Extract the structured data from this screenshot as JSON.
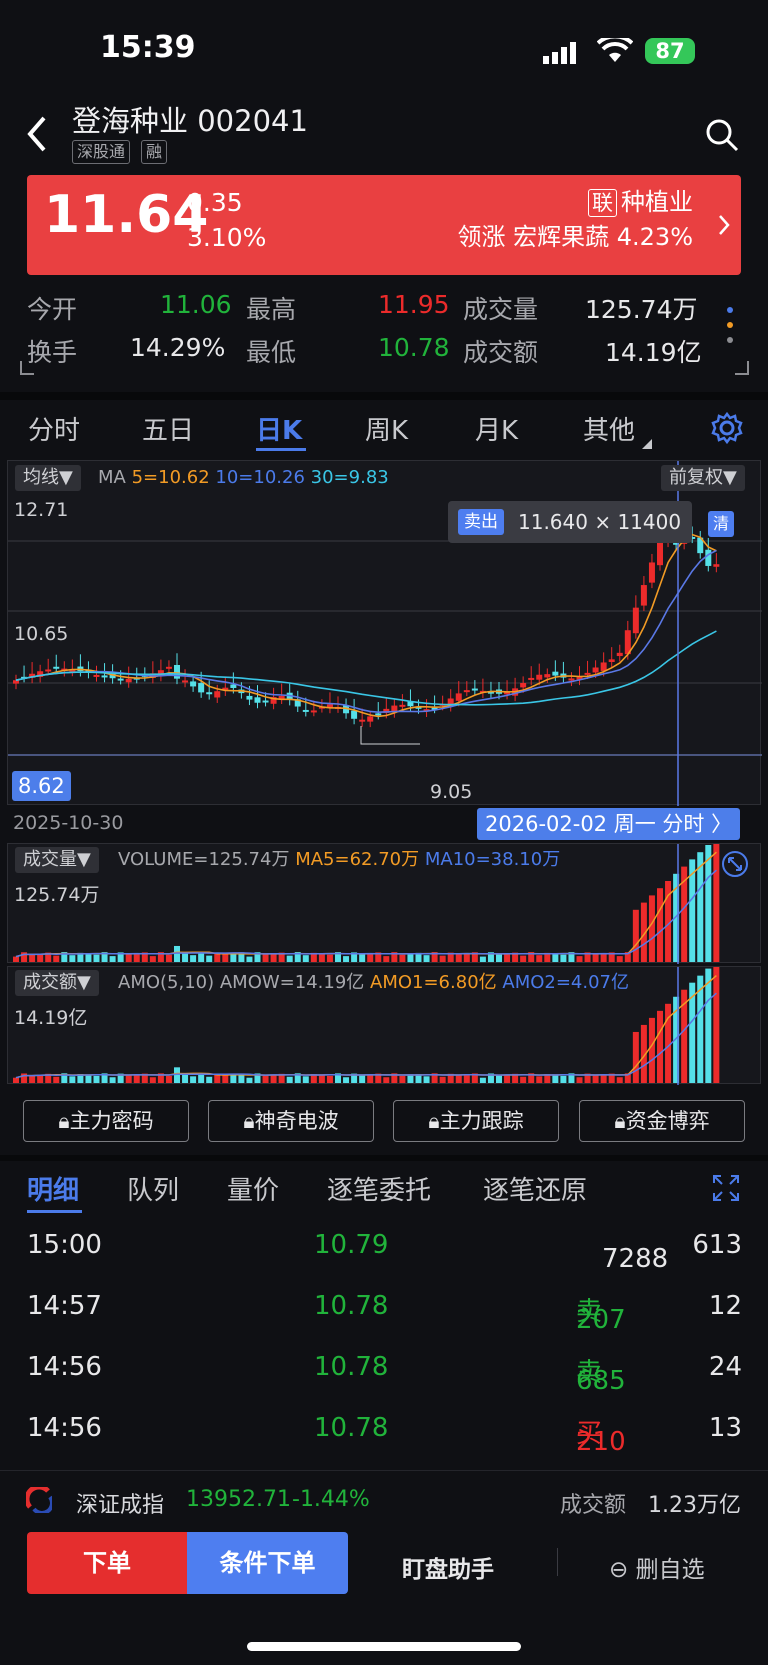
{
  "status": {
    "time": "15:39",
    "battery": "87"
  },
  "header": {
    "title": "登海种业 002041",
    "tags": [
      "深股通",
      "融"
    ]
  },
  "banner": {
    "price": "11.64",
    "change": "0.35",
    "change_pct": "3.10%",
    "sector_badge": "联",
    "sector": "种植业",
    "leader": "领涨 宏辉果蔬 4.23%",
    "color": "#e94041"
  },
  "stats": {
    "open_label": "今开",
    "open": "11.06",
    "high_label": "最高",
    "high": "11.95",
    "volume_label": "成交量",
    "volume": "125.74万",
    "turnover_label": "换手",
    "turnover": "14.29%",
    "low_label": "最低",
    "low": "10.78",
    "amount_label": "成交额",
    "amount": "14.19亿"
  },
  "ktabs": [
    "分时",
    "五日",
    "日K",
    "周K",
    "月K",
    "其他"
  ],
  "main_chart": {
    "ma_chip": "均线▼",
    "ma_label": "MA",
    "ma5": "5=10.62",
    "ma10": "10=10.26",
    "ma30": "30=9.83",
    "adjust_chip": "前复权▼",
    "y_top": "12.71",
    "y_mid": "10.65",
    "y_bottom": "8.62",
    "low_marker": "9.05",
    "tooltip_badge": "卖出",
    "tooltip_text": "11.640 × 11400",
    "clear_badge": "清",
    "date_left": "2025-10-30",
    "date_right": "2026-02-02 周一 分时 〉"
  },
  "vol_chart": {
    "chip": "成交量▼",
    "legend_main": "VOLUME=125.74万",
    "ma5": "MA5=62.70万",
    "ma10": "MA10=38.10万",
    "y_top": "125.74万"
  },
  "amo_chart": {
    "chip": "成交额▼",
    "legend_main": "AMO(5,10)  AMOW=14.19亿",
    "amo1": "AMO1=6.80亿",
    "amo2": "AMO2=4.07亿",
    "y_top": "14.19亿"
  },
  "tools": [
    "主力密码",
    "神奇电波",
    "主力跟踪",
    "资金博弈"
  ],
  "detail_tabs": [
    "明细",
    "队列",
    "量价",
    "逐笔委托",
    "逐笔还原"
  ],
  "trades": [
    {
      "time": "15:00",
      "price": "10.79",
      "vol": "7288",
      "side": "",
      "count": "613",
      "vol_color": "#e8e8ea"
    },
    {
      "time": "14:57",
      "price": "10.78",
      "vol": "207",
      "side": "卖",
      "count": "12",
      "vol_color": "#21b33b"
    },
    {
      "time": "14:56",
      "price": "10.78",
      "vol": "685",
      "side": "卖",
      "count": "24",
      "vol_color": "#21b33b"
    },
    {
      "time": "14:56",
      "price": "10.78",
      "vol": "210",
      "side": "买",
      "count": "13",
      "vol_color": "#ec2b2b"
    }
  ],
  "index_bar": {
    "name": "深证成指",
    "value": "13952.71",
    "pct": "-1.44%",
    "amount_label": "成交额",
    "amount": "1.23万亿"
  },
  "actions": {
    "order": "下单",
    "cond_order": "条件下单",
    "helper": "盯盘助手",
    "remove": "删自选"
  },
  "colors": {
    "up": "#ec2b2b",
    "down": "#21b33b",
    "accent": "#4b7bea",
    "cyan": "#55e0e8"
  }
}
